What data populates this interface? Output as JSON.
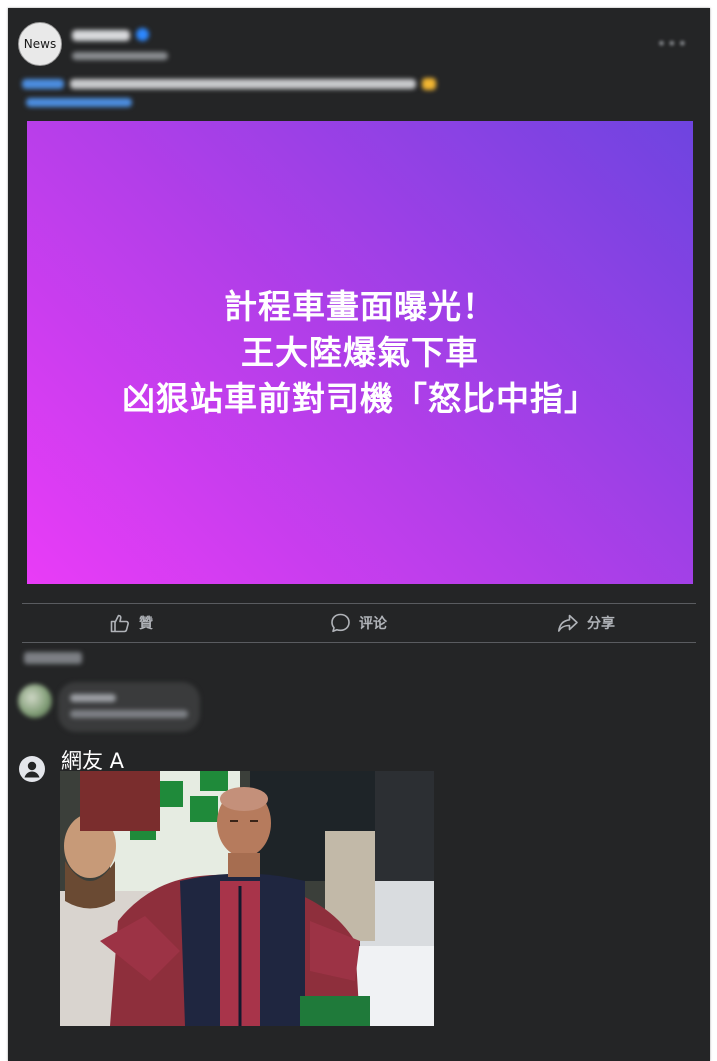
{
  "post": {
    "avatar_text": "News",
    "hero_lines": [
      "計程車畫面曝光！",
      "王大陸爆氣下車",
      "凶狠站車前對司機「怒比中指」"
    ]
  },
  "actions": {
    "like_label": "贊",
    "comment_label": "评论",
    "share_label": "分享"
  },
  "comment": {
    "author": "網友 A",
    "icons": {
      "user": "user-circle-icon",
      "like": "thumbs-up-icon",
      "comment": "comment-bubble-icon",
      "share": "share-arrow-icon"
    }
  },
  "colors": {
    "card_bg": "#242526",
    "hero_gradient_start": "#e93cf7",
    "hero_gradient_end": "#6e44e0",
    "action_text": "#b0b3b8"
  }
}
